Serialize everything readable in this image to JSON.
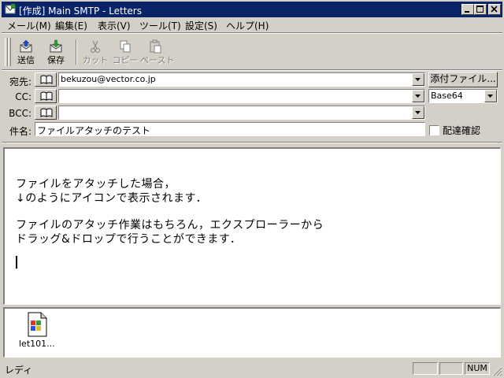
{
  "window": {
    "title": "[作成] Main SMTP - Letters",
    "controls": [
      "minimize-icon",
      "maximize-icon",
      "close-icon"
    ]
  },
  "menu": {
    "mail": "メール(M)",
    "edit": "編集(E)",
    "view": "表示(V)",
    "tools": "ツール(T)",
    "settings": "設定(S)",
    "help": "ヘルプ(H)"
  },
  "toolbar": {
    "send": "送信",
    "save": "保存",
    "cut": "カット",
    "copy": "コピー",
    "paste": "ペースト"
  },
  "header": {
    "to_label": "宛先:",
    "to_value": "bekuzou@vector.co.jp",
    "cc_label": "CC:",
    "cc_value": "",
    "bcc_label": "BCC:",
    "bcc_value": "",
    "subject_label": "件名:",
    "subject_value": "ファイルアタッチのテスト",
    "attach_button": "添付ファイル...",
    "encoding_value": "Base64",
    "delivery_confirm_label": "配達確認",
    "delivery_confirm_checked": false
  },
  "body": {
    "lines": [
      "ファイルをアタッチした場合，",
      "↓のようにアイコンで表示されます．",
      "ファイルのアタッチ作業はもちろん，エクスプローラーから",
      "ドラッグ&ドロップで行うことができます．"
    ]
  },
  "attachments": [
    {
      "name": "let101...",
      "icon": "file-icon"
    }
  ],
  "status": {
    "text": "レディ",
    "num": "NUM"
  },
  "colors": {
    "titlebar": "#0a246a",
    "face": "#d4d0c8"
  }
}
